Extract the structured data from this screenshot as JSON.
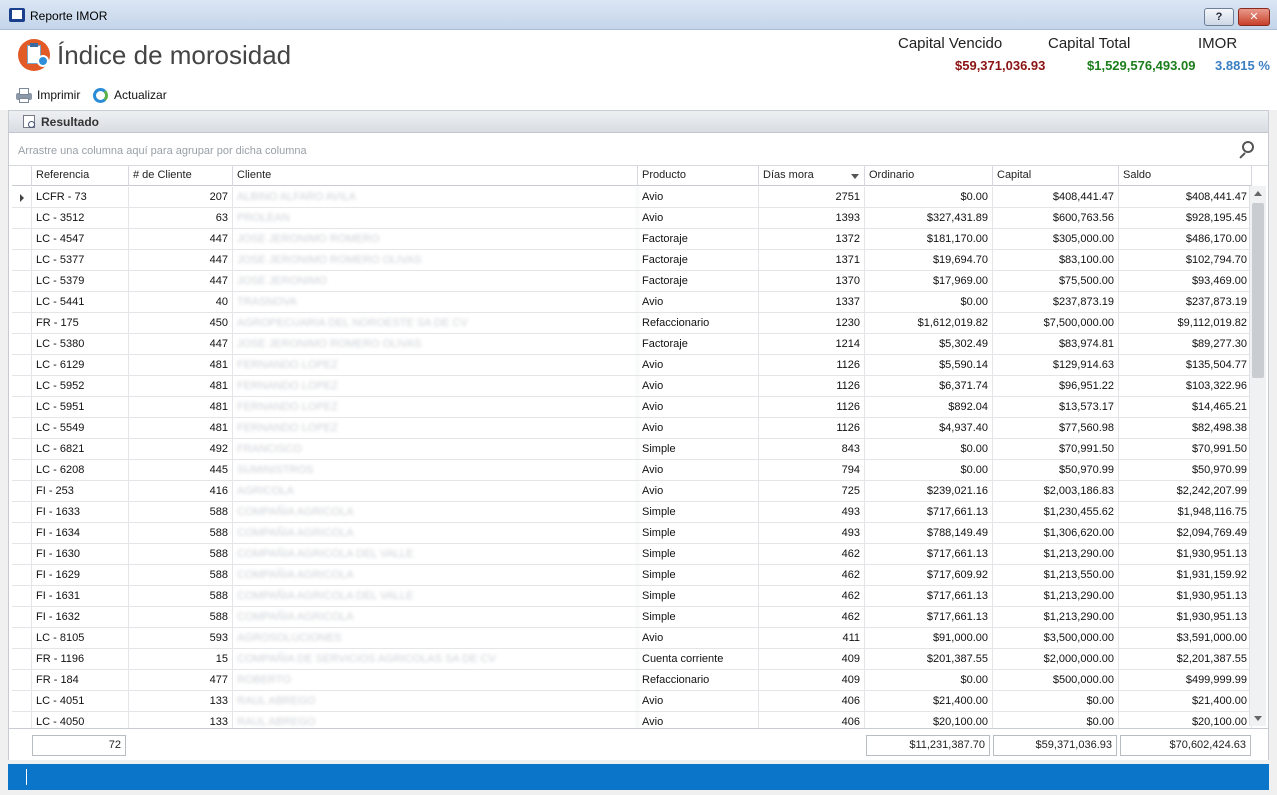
{
  "window": {
    "title": "Reporte IMOR",
    "help_label": "?",
    "close_label": "✕"
  },
  "header": {
    "page_title": "Índice de morosidad"
  },
  "summary": {
    "capital_vencido_label": "Capital Vencido",
    "capital_vencido_value": "$59,371,036.93",
    "capital_total_label": "Capital Total",
    "capital_total_value": "$1,529,576,493.09",
    "imor_label": "IMOR",
    "imor_value": "3.8815 %",
    "colors": {
      "vencido": "#8b1313",
      "total": "#1b7d1b",
      "imor": "#3b7fc2"
    }
  },
  "toolbar": {
    "print_label": "Imprimir",
    "refresh_label": "Actualizar"
  },
  "panel": {
    "title": "Resultado",
    "group_hint": "Arrastre una columna aquí para agrupar por dicha columna"
  },
  "grid": {
    "columns": [
      "Referencia",
      "# de Cliente",
      "Cliente",
      "Producto",
      "Días mora",
      "Ordinario",
      "Capital",
      "Saldo"
    ],
    "rows": [
      {
        "ref": "LCFR - 73",
        "cliente_num": "207",
        "cliente": "ALBINO ALFARO AVILA",
        "producto": "Avio",
        "dias": "2751",
        "ordinario": "$0.00",
        "capital": "$408,441.47",
        "saldo": "$408,441.47"
      },
      {
        "ref": "LC - 3512",
        "cliente_num": "63",
        "cliente": "PROLEAN",
        "producto": "Avio",
        "dias": "1393",
        "ordinario": "$327,431.89",
        "capital": "$600,763.56",
        "saldo": "$928,195.45"
      },
      {
        "ref": "LC - 4547",
        "cliente_num": "447",
        "cliente": "JOSE JERONIMO ROMERO",
        "producto": "Factoraje",
        "dias": "1372",
        "ordinario": "$181,170.00",
        "capital": "$305,000.00",
        "saldo": "$486,170.00"
      },
      {
        "ref": "LC - 5377",
        "cliente_num": "447",
        "cliente": "JOSE JERONIMO ROMERO OLIVAS",
        "producto": "Factoraje",
        "dias": "1371",
        "ordinario": "$19,694.70",
        "capital": "$83,100.00",
        "saldo": "$102,794.70"
      },
      {
        "ref": "LC - 5379",
        "cliente_num": "447",
        "cliente": "JOSE JERONIMO",
        "producto": "Factoraje",
        "dias": "1370",
        "ordinario": "$17,969.00",
        "capital": "$75,500.00",
        "saldo": "$93,469.00"
      },
      {
        "ref": "LC - 5441",
        "cliente_num": "40",
        "cliente": "TRASNOVA",
        "producto": "Avio",
        "dias": "1337",
        "ordinario": "$0.00",
        "capital": "$237,873.19",
        "saldo": "$237,873.19"
      },
      {
        "ref": "FR - 175",
        "cliente_num": "450",
        "cliente": "AGROPECUARIA DEL NOROESTE SA DE CV",
        "producto": "Refaccionario",
        "dias": "1230",
        "ordinario": "$1,612,019.82",
        "capital": "$7,500,000.00",
        "saldo": "$9,112,019.82"
      },
      {
        "ref": "LC - 5380",
        "cliente_num": "447",
        "cliente": "JOSE JERONIMO ROMERO OLIVAS",
        "producto": "Factoraje",
        "dias": "1214",
        "ordinario": "$5,302.49",
        "capital": "$83,974.81",
        "saldo": "$89,277.30"
      },
      {
        "ref": "LC - 6129",
        "cliente_num": "481",
        "cliente": "FERNANDO LOPEZ",
        "producto": "Avio",
        "dias": "1126",
        "ordinario": "$5,590.14",
        "capital": "$129,914.63",
        "saldo": "$135,504.77"
      },
      {
        "ref": "LC - 5952",
        "cliente_num": "481",
        "cliente": "FERNANDO LOPEZ",
        "producto": "Avio",
        "dias": "1126",
        "ordinario": "$6,371.74",
        "capital": "$96,951.22",
        "saldo": "$103,322.96"
      },
      {
        "ref": "LC - 5951",
        "cliente_num": "481",
        "cliente": "FERNANDO LOPEZ",
        "producto": "Avio",
        "dias": "1126",
        "ordinario": "$892.04",
        "capital": "$13,573.17",
        "saldo": "$14,465.21"
      },
      {
        "ref": "LC - 5549",
        "cliente_num": "481",
        "cliente": "FERNANDO LOPEZ",
        "producto": "Avio",
        "dias": "1126",
        "ordinario": "$4,937.40",
        "capital": "$77,560.98",
        "saldo": "$82,498.38"
      },
      {
        "ref": "LC - 6821",
        "cliente_num": "492",
        "cliente": "FRANCISCO",
        "producto": "Simple",
        "dias": "843",
        "ordinario": "$0.00",
        "capital": "$70,991.50",
        "saldo": "$70,991.50"
      },
      {
        "ref": "LC - 6208",
        "cliente_num": "445",
        "cliente": "SUMINISTROS",
        "producto": "Avio",
        "dias": "794",
        "ordinario": "$0.00",
        "capital": "$50,970.99",
        "saldo": "$50,970.99"
      },
      {
        "ref": "FI - 253",
        "cliente_num": "416",
        "cliente": "AGRICOLA",
        "producto": "Avio",
        "dias": "725",
        "ordinario": "$239,021.16",
        "capital": "$2,003,186.83",
        "saldo": "$2,242,207.99"
      },
      {
        "ref": "FI - 1633",
        "cliente_num": "588",
        "cliente": "COMPAÑIA AGRICOLA",
        "producto": "Simple",
        "dias": "493",
        "ordinario": "$717,661.13",
        "capital": "$1,230,455.62",
        "saldo": "$1,948,116.75"
      },
      {
        "ref": "FI - 1634",
        "cliente_num": "588",
        "cliente": "COMPAÑIA AGRICOLA",
        "producto": "Simple",
        "dias": "493",
        "ordinario": "$788,149.49",
        "capital": "$1,306,620.00",
        "saldo": "$2,094,769.49"
      },
      {
        "ref": "FI - 1630",
        "cliente_num": "588",
        "cliente": "COMPAÑIA AGRICOLA DEL VALLE",
        "producto": "Simple",
        "dias": "462",
        "ordinario": "$717,661.13",
        "capital": "$1,213,290.00",
        "saldo": "$1,930,951.13"
      },
      {
        "ref": "FI - 1629",
        "cliente_num": "588",
        "cliente": "COMPAÑIA AGRICOLA",
        "producto": "Simple",
        "dias": "462",
        "ordinario": "$717,609.92",
        "capital": "$1,213,550.00",
        "saldo": "$1,931,159.92"
      },
      {
        "ref": "FI - 1631",
        "cliente_num": "588",
        "cliente": "COMPAÑIA AGRICOLA DEL VALLE",
        "producto": "Simple",
        "dias": "462",
        "ordinario": "$717,661.13",
        "capital": "$1,213,290.00",
        "saldo": "$1,930,951.13"
      },
      {
        "ref": "FI - 1632",
        "cliente_num": "588",
        "cliente": "COMPAÑIA AGRICOLA",
        "producto": "Simple",
        "dias": "462",
        "ordinario": "$717,661.13",
        "capital": "$1,213,290.00",
        "saldo": "$1,930,951.13"
      },
      {
        "ref": "LC - 8105",
        "cliente_num": "593",
        "cliente": "AGROSOLUCIONES",
        "producto": "Avio",
        "dias": "411",
        "ordinario": "$91,000.00",
        "capital": "$3,500,000.00",
        "saldo": "$3,591,000.00"
      },
      {
        "ref": "FR - 1196",
        "cliente_num": "15",
        "cliente": "COMPAÑIA DE SERVICIOS AGRICOLAS SA DE CV",
        "producto": "Cuenta corriente",
        "dias": "409",
        "ordinario": "$201,387.55",
        "capital": "$2,000,000.00",
        "saldo": "$2,201,387.55"
      },
      {
        "ref": "FR - 184",
        "cliente_num": "477",
        "cliente": "ROBERTO",
        "producto": "Refaccionario",
        "dias": "409",
        "ordinario": "$0.00",
        "capital": "$500,000.00",
        "saldo": "$499,999.99"
      },
      {
        "ref": "LC - 4051",
        "cliente_num": "133",
        "cliente": "RAUL ABREGO",
        "producto": "Avio",
        "dias": "406",
        "ordinario": "$21,400.00",
        "capital": "$0.00",
        "saldo": "$21,400.00"
      },
      {
        "ref": "LC - 4050",
        "cliente_num": "133",
        "cliente": "RAUL ABREGO",
        "producto": "Avio",
        "dias": "406",
        "ordinario": "$20,100.00",
        "capital": "$0.00",
        "saldo": "$20,100.00"
      }
    ],
    "footer": {
      "count": "72",
      "ordinario_total": "$11,231,387.70",
      "capital_total": "$59,371,036.93",
      "saldo_total": "$70,602,424.63"
    }
  }
}
